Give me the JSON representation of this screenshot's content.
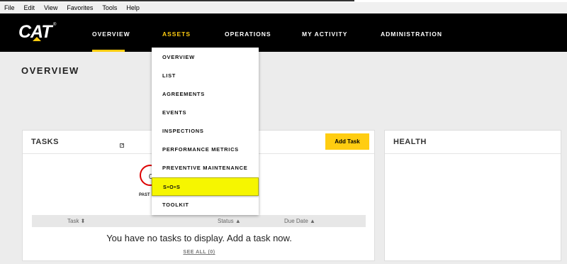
{
  "browser_menu": [
    "File",
    "Edit",
    "View",
    "Favorites",
    "Tools",
    "Help"
  ],
  "brand": {
    "logo_text": "CAT",
    "registered": "®"
  },
  "nav": {
    "items": [
      "OVERVIEW",
      "ASSETS",
      "OPERATIONS",
      "MY ACTIVITY",
      "ADMINISTRATION"
    ],
    "active": "OVERVIEW",
    "open_menu": "ASSETS"
  },
  "page": {
    "title": "OVERVIEW"
  },
  "assets_dropdown": {
    "items": [
      "OVERVIEW",
      "LIST",
      "AGREEMENTS",
      "EVENTS",
      "INSPECTIONS",
      "PERFORMANCE METRICS",
      "PREVENTIVE MAINTENANCE",
      "S•O•S",
      "TOOLKIT"
    ],
    "highlighted": "S•O•S"
  },
  "tasks": {
    "title": "TASKS",
    "add_button": "Add Task",
    "past_due_count": "0",
    "past_label": "PAST",
    "columns": [
      "Task ⬍",
      "Status ▲",
      "Due Date ▲"
    ],
    "empty_message": "You have no tasks to display. Add a task now.",
    "see_all": "SEE ALL (0)"
  },
  "health": {
    "title": "HEALTH"
  },
  "colors": {
    "accent": "#ffcd11",
    "nav_bg": "#000000",
    "highlight": "#f6f600",
    "indicator": "#dd0000"
  }
}
